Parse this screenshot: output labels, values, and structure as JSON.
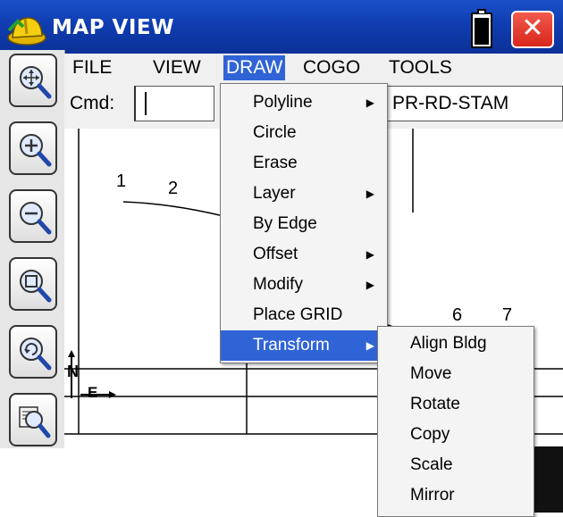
{
  "window": {
    "title": "MAP VIEW",
    "close_label": "✕",
    "icons": [
      "hard-hat-icon",
      "battery-icon",
      "close-icon"
    ]
  },
  "toolbar": {
    "buttons": [
      "zoom-extents-icon",
      "zoom-in-icon",
      "zoom-out-icon",
      "zoom-window-icon",
      "zoom-previous-icon",
      "display-settings-icon"
    ]
  },
  "menubar": {
    "items": [
      "FILE",
      "VIEW",
      "DRAW",
      "COGO",
      "TOOLS"
    ],
    "active": "DRAW"
  },
  "cmd": {
    "label": "Cmd:",
    "value": "",
    "code": "PR-RD-STAM"
  },
  "map": {
    "point_labels": [
      "1",
      "2",
      "6",
      "7"
    ],
    "north_label": "N",
    "east_label": "E"
  },
  "draw_menu": {
    "items": [
      {
        "label": "Polyline",
        "submenu": true
      },
      {
        "label": "Circle",
        "submenu": false
      },
      {
        "label": "Erase",
        "submenu": false
      },
      {
        "label": "Layer",
        "submenu": true
      },
      {
        "label": "By Edge",
        "submenu": false
      },
      {
        "label": "Offset",
        "submenu": true
      },
      {
        "label": "Modify",
        "submenu": true
      },
      {
        "label": "Place GRID",
        "submenu": false
      },
      {
        "label": "Transform",
        "submenu": true
      }
    ],
    "highlighted": "Transform",
    "arrow": "▶"
  },
  "transform_menu": {
    "items": [
      "Align Bldg",
      "Move",
      "Rotate",
      "Copy",
      "Scale",
      "Mirror"
    ]
  },
  "colors": {
    "titlebar": "#0f3cae",
    "highlight": "#3064d6",
    "close": "#d9261c"
  }
}
